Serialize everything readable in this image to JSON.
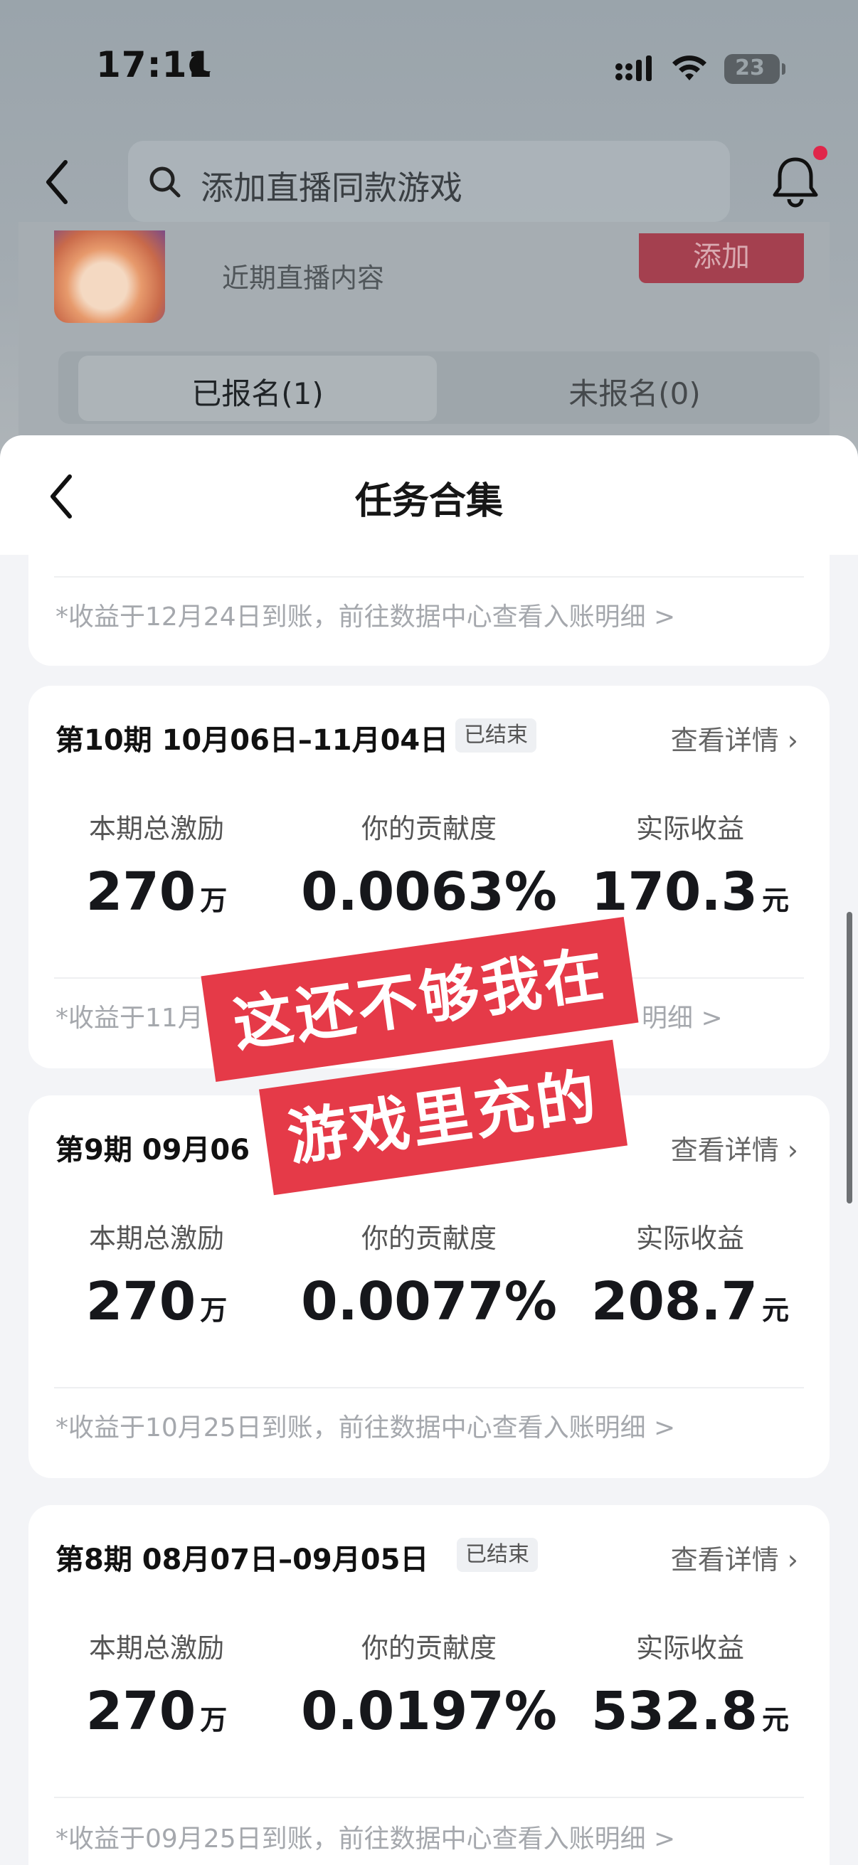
{
  "status_bar": {
    "time": "17:11",
    "battery": "23"
  },
  "topbar": {
    "search_placeholder": "添加直播同款游戏"
  },
  "game": {
    "subtitle": "近期直播内容",
    "add_label": "添加"
  },
  "tabs": [
    {
      "label": "已报名(1)",
      "active": true
    },
    {
      "label": "未报名(0)",
      "active": false
    }
  ],
  "sheet": {
    "title": "任务合集",
    "top_note": "收益于12月24日到账，前往数据中心查看入账明细 >",
    "cards": [
      {
        "period": "第10期  10月06日–11月04日",
        "badge": "已结束",
        "detail": "查看详情",
        "labels": [
          "本期总激励",
          "你的贡献度",
          "实际收益"
        ],
        "total": "270",
        "total_unit": "万",
        "contribution": "0.0063%",
        "income": "170.3",
        "income_unit": "元",
        "note": "收益于11月"
      },
      {
        "period": "第9期  09月06",
        "badge": "",
        "detail": "查看详情",
        "labels": [
          "本期总激励",
          "你的贡献度",
          "实际收益"
        ],
        "total": "270",
        "total_unit": "万",
        "contribution": "0.0077%",
        "income": "208.7",
        "income_unit": "元",
        "note": "收益于10月25日到账，前往数据中心查看入账明细 >"
      },
      {
        "period": "第8期  08月07日–09月05日",
        "badge": "已结束",
        "detail": "查看详情",
        "labels": [
          "本期总激励",
          "你的贡献度",
          "实际收益"
        ],
        "total": "270",
        "total_unit": "万",
        "contribution": "0.0197%",
        "income": "532.8",
        "income_unit": "元",
        "note": "收益于09月25日到账，前往数据中心查看入账明细 >"
      }
    ],
    "card1_note_tail": "明细 >"
  },
  "overlay": {
    "line1": "这还不够我在",
    "line2": "游戏里充的",
    "color": "#e53a48"
  }
}
